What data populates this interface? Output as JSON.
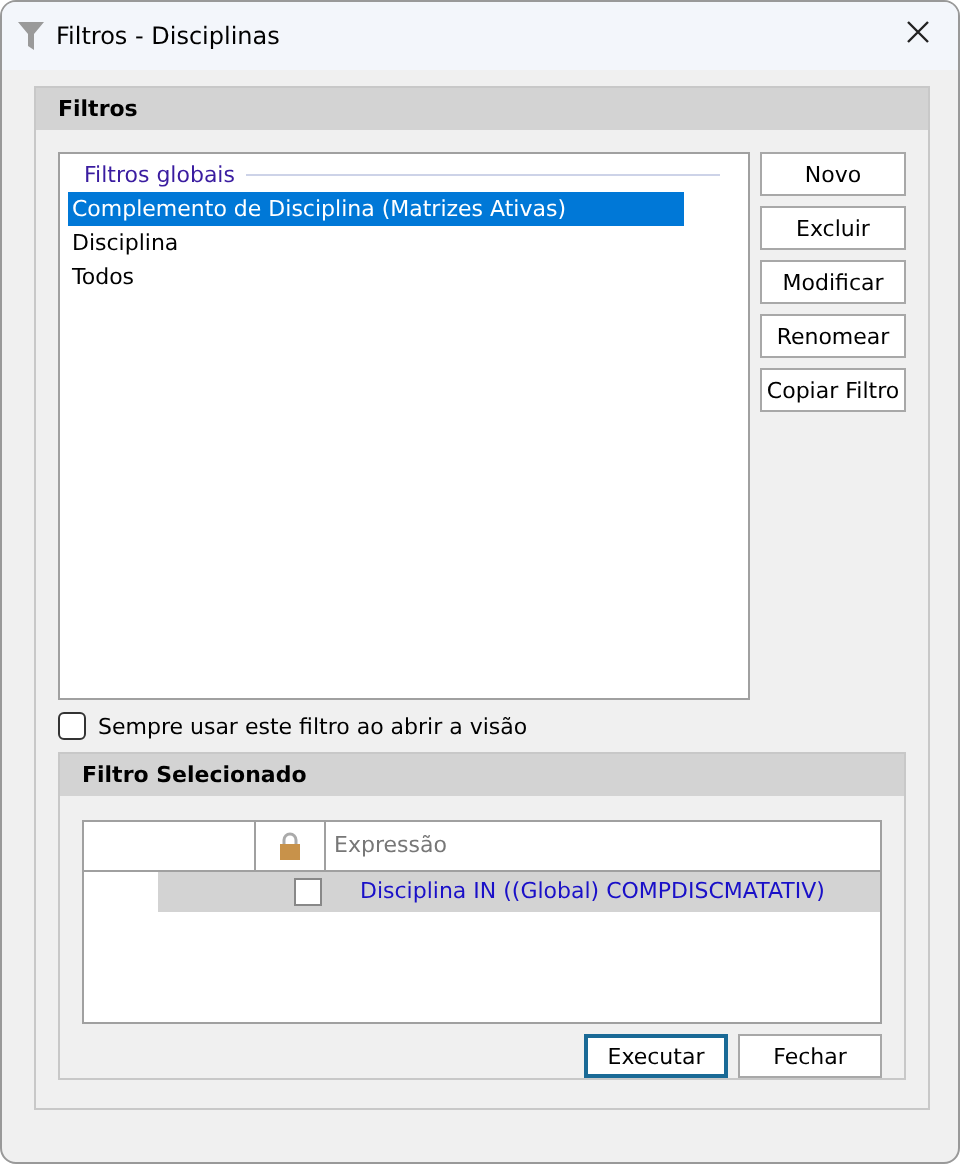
{
  "window": {
    "title": "Filtros - Disciplinas"
  },
  "filters_panel": {
    "title": "Filtros",
    "group_label": "Filtros globais",
    "items": [
      {
        "label": "Complemento de Disciplina (Matrizes Ativas)",
        "selected": true
      },
      {
        "label": "Disciplina",
        "selected": false
      },
      {
        "label": "Todos",
        "selected": false
      }
    ],
    "buttons": [
      "Novo",
      "Excluir",
      "Modificar",
      "Renomear",
      "Copiar Filtro"
    ]
  },
  "always_use": {
    "label": "Sempre usar este filtro ao abrir a visão",
    "checked": false
  },
  "selected_filter": {
    "title": "Filtro Selecionado",
    "columns": [
      "Expressão"
    ],
    "rows": [
      {
        "locked": false,
        "expression": "Disciplina IN ((Global) COMPDISCMATATIV)",
        "selected": true
      }
    ]
  },
  "buttons": [
    {
      "label": "Executar",
      "default": true
    },
    {
      "label": "Fechar",
      "default": false
    }
  ]
}
